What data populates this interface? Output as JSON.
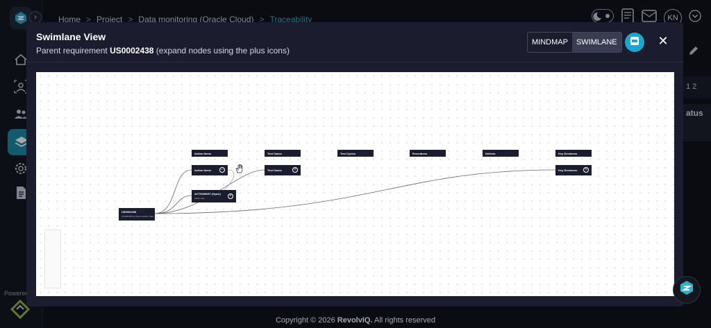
{
  "breadcrumb": {
    "home": "Home",
    "project": "Project",
    "monitoring": "Data monitoring (Oracle Cloud)",
    "current": "Traceability",
    "separator": ">"
  },
  "user": {
    "initials": "KN"
  },
  "background": {
    "pagination_label": "1  2",
    "status_header": "atus"
  },
  "sidebar": {
    "powered_label": "Powered"
  },
  "footer": {
    "copyright": "Copyright © 2026",
    "brand": "RevolvIQ.",
    "rights": "All rights reserved"
  },
  "modal": {
    "title": "Swimlane View",
    "subtitle_prefix": "Parent requirement",
    "requirement_id": "US0002438",
    "subtitle_suffix": "(expand nodes using the plus icons)",
    "toggle": {
      "mindmap": "MINDMAP",
      "swimlane": "SWIMLANE"
    },
    "close": "✕",
    "pdf_icon": "pdf-icon"
  },
  "swimlane": {
    "lanes": [
      {
        "header": "Action Items",
        "node": "Action Items"
      },
      {
        "header": "Test Cases",
        "node": "Test Cases"
      },
      {
        "header": "Test Cycles"
      },
      {
        "header": "Executions"
      },
      {
        "header": "Defects"
      },
      {
        "header": "Key Decisions",
        "node": "Key Decisions"
      }
    ],
    "root": {
      "id": "US0002438",
      "desc": "US0002438 as Karen Hanley Start"
    },
    "action_item": {
      "id": "ACT0000057 (Open)",
      "desc": "Action Item"
    },
    "plus": "+"
  },
  "colors": {
    "accent": "#1b8ca6",
    "breadcrumb_current": "#2bb0d6",
    "pdf": "#1aa6d2",
    "node_bg": "#1b1d2e"
  }
}
